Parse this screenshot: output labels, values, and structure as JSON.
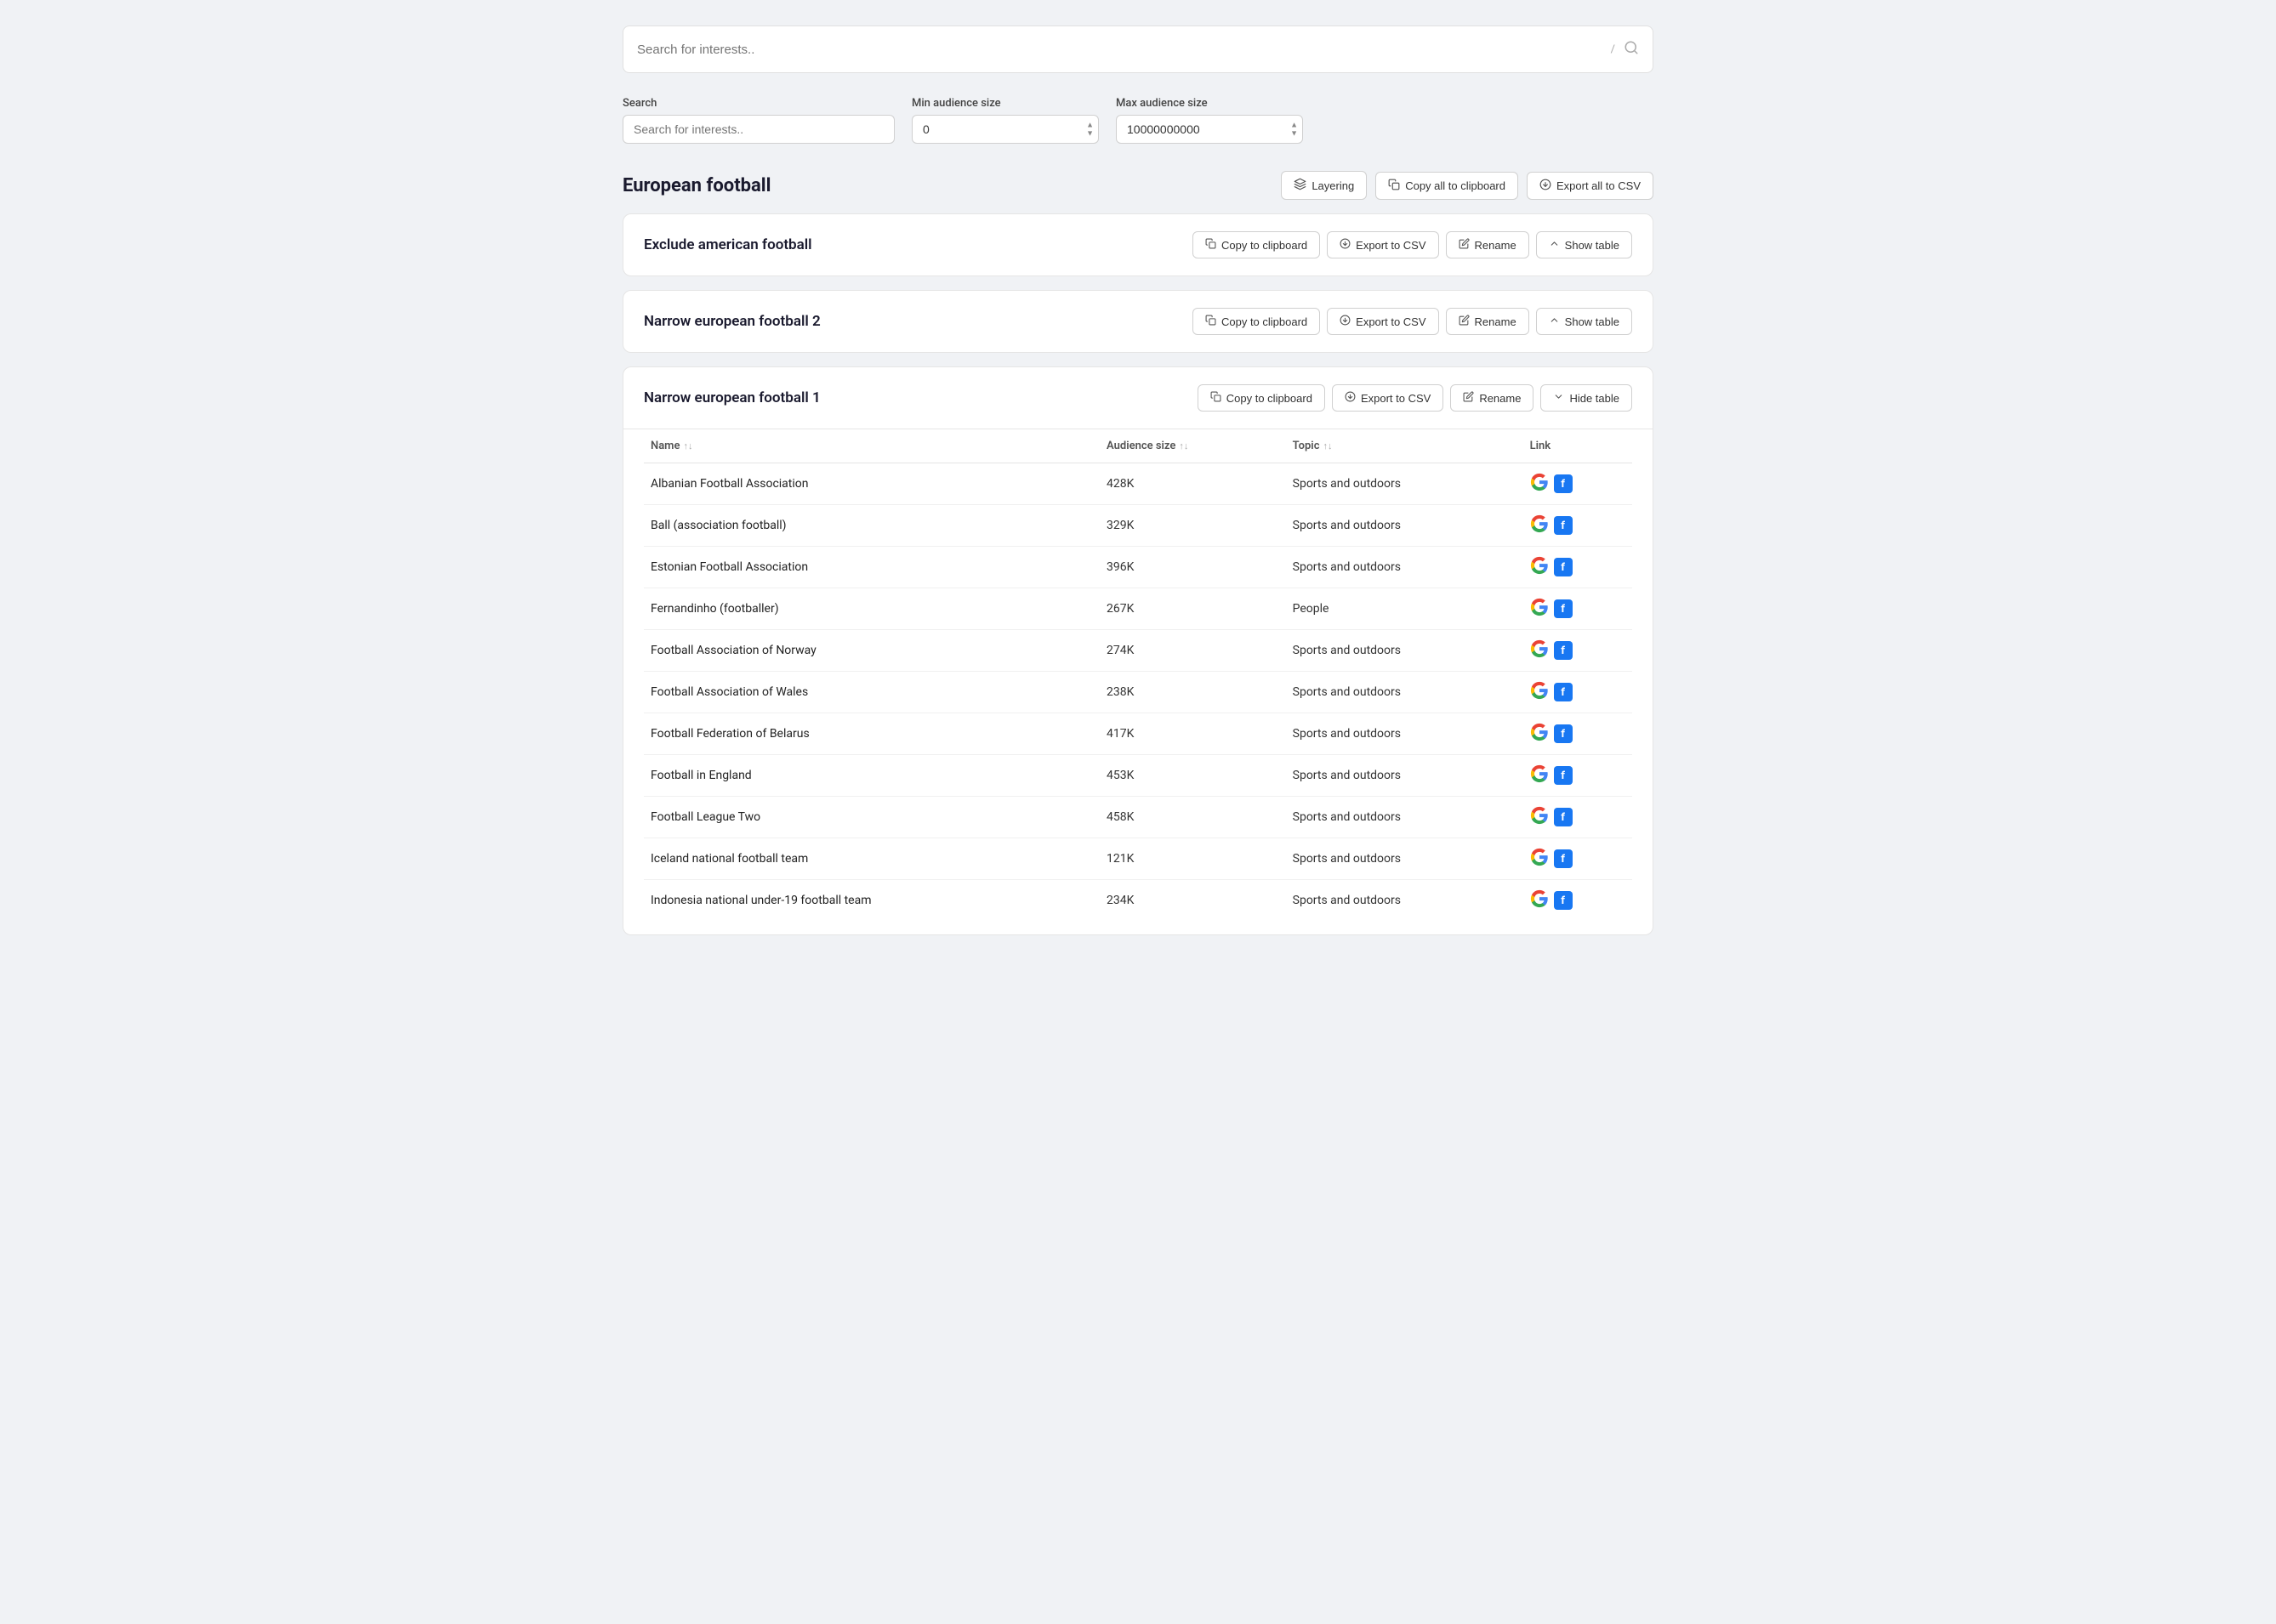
{
  "topSearch": {
    "placeholder": "Search for interests..",
    "shortcutKey": "/",
    "searchIcon": "🔍"
  },
  "filters": {
    "search": {
      "label": "Search",
      "placeholder": "Search for interests.."
    },
    "minAudienceSize": {
      "label": "Min audience size",
      "value": "0"
    },
    "maxAudienceSize": {
      "label": "Max audience size",
      "value": "10000000000"
    }
  },
  "section": {
    "title": "European football",
    "buttons": {
      "layering": "Layering",
      "copyAll": "Copy all to clipboard",
      "exportAll": "Export all to CSV"
    }
  },
  "cards": [
    {
      "id": "exclude-american-football",
      "title": "Exclude american football",
      "actions": {
        "copy": "Copy to clipboard",
        "export": "Export to CSV",
        "rename": "Rename",
        "showTable": "Show table"
      },
      "showTable": false
    },
    {
      "id": "narrow-european-football-2",
      "title": "Narrow european football 2",
      "actions": {
        "copy": "Copy to clipboard",
        "export": "Export to CSV",
        "rename": "Rename",
        "showTable": "Show table"
      },
      "showTable": false
    },
    {
      "id": "narrow-european-football-1",
      "title": "Narrow european football 1",
      "actions": {
        "copy": "Copy to clipboard",
        "export": "Export to CSV",
        "rename": "Rename",
        "showTable": "Hide table"
      },
      "showTable": true,
      "columns": [
        "Name",
        "Audience size",
        "Topic",
        "Link"
      ],
      "rows": [
        {
          "name": "Albanian Football Association",
          "audience": "428K",
          "topic": "Sports and outdoors"
        },
        {
          "name": "Ball (association football)",
          "audience": "329K",
          "topic": "Sports and outdoors"
        },
        {
          "name": "Estonian Football Association",
          "audience": "396K",
          "topic": "Sports and outdoors"
        },
        {
          "name": "Fernandinho (footballer)",
          "audience": "267K",
          "topic": "People"
        },
        {
          "name": "Football Association of Norway",
          "audience": "274K",
          "topic": "Sports and outdoors"
        },
        {
          "name": "Football Association of Wales",
          "audience": "238K",
          "topic": "Sports and outdoors"
        },
        {
          "name": "Football Federation of Belarus",
          "audience": "417K",
          "topic": "Sports and outdoors"
        },
        {
          "name": "Football in England",
          "audience": "453K",
          "topic": "Sports and outdoors"
        },
        {
          "name": "Football League Two",
          "audience": "458K",
          "topic": "Sports and outdoors"
        },
        {
          "name": "Iceland national football team",
          "audience": "121K",
          "topic": "Sports and outdoors"
        },
        {
          "name": "Indonesia national under-19 football team",
          "audience": "234K",
          "topic": "Sports and outdoors"
        }
      ]
    }
  ]
}
